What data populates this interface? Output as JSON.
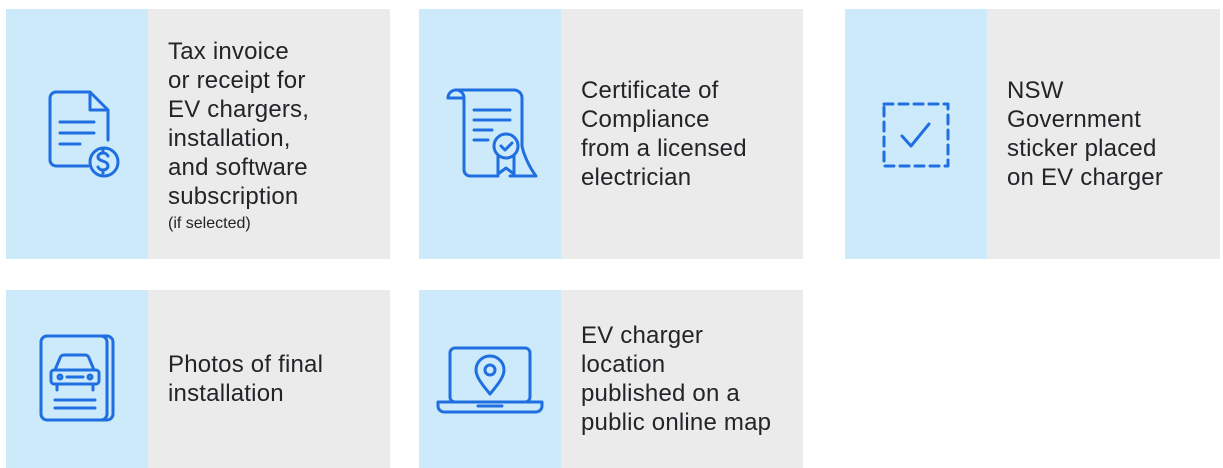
{
  "cards": [
    {
      "icon": "invoice-dollar-icon",
      "text": "Tax invoice or receipt for EV chargers, installation, and software subscription",
      "lines": [
        "Tax invoice",
        "or receipt for",
        "EV chargers,",
        "installation,",
        "and software",
        "subscription"
      ],
      "note": "(if selected)"
    },
    {
      "icon": "certificate-icon",
      "lines": [
        "Certificate of",
        "Compliance",
        "from a licensed",
        "electrician"
      ]
    },
    {
      "icon": "sticker-check-icon",
      "lines": [
        "NSW",
        "Government",
        "sticker placed",
        "on EV charger"
      ]
    },
    {
      "icon": "car-photo-icon",
      "lines": [
        "Photos of final",
        "installation"
      ]
    },
    {
      "icon": "laptop-map-pin-icon",
      "lines": [
        "EV charger",
        "location",
        "published on a",
        "public online map"
      ]
    }
  ],
  "colors": {
    "icon_bg": "#cdeafb",
    "text_bg": "#ebebeb",
    "icon_stroke": "#1f6fe0",
    "text": "#222427"
  }
}
